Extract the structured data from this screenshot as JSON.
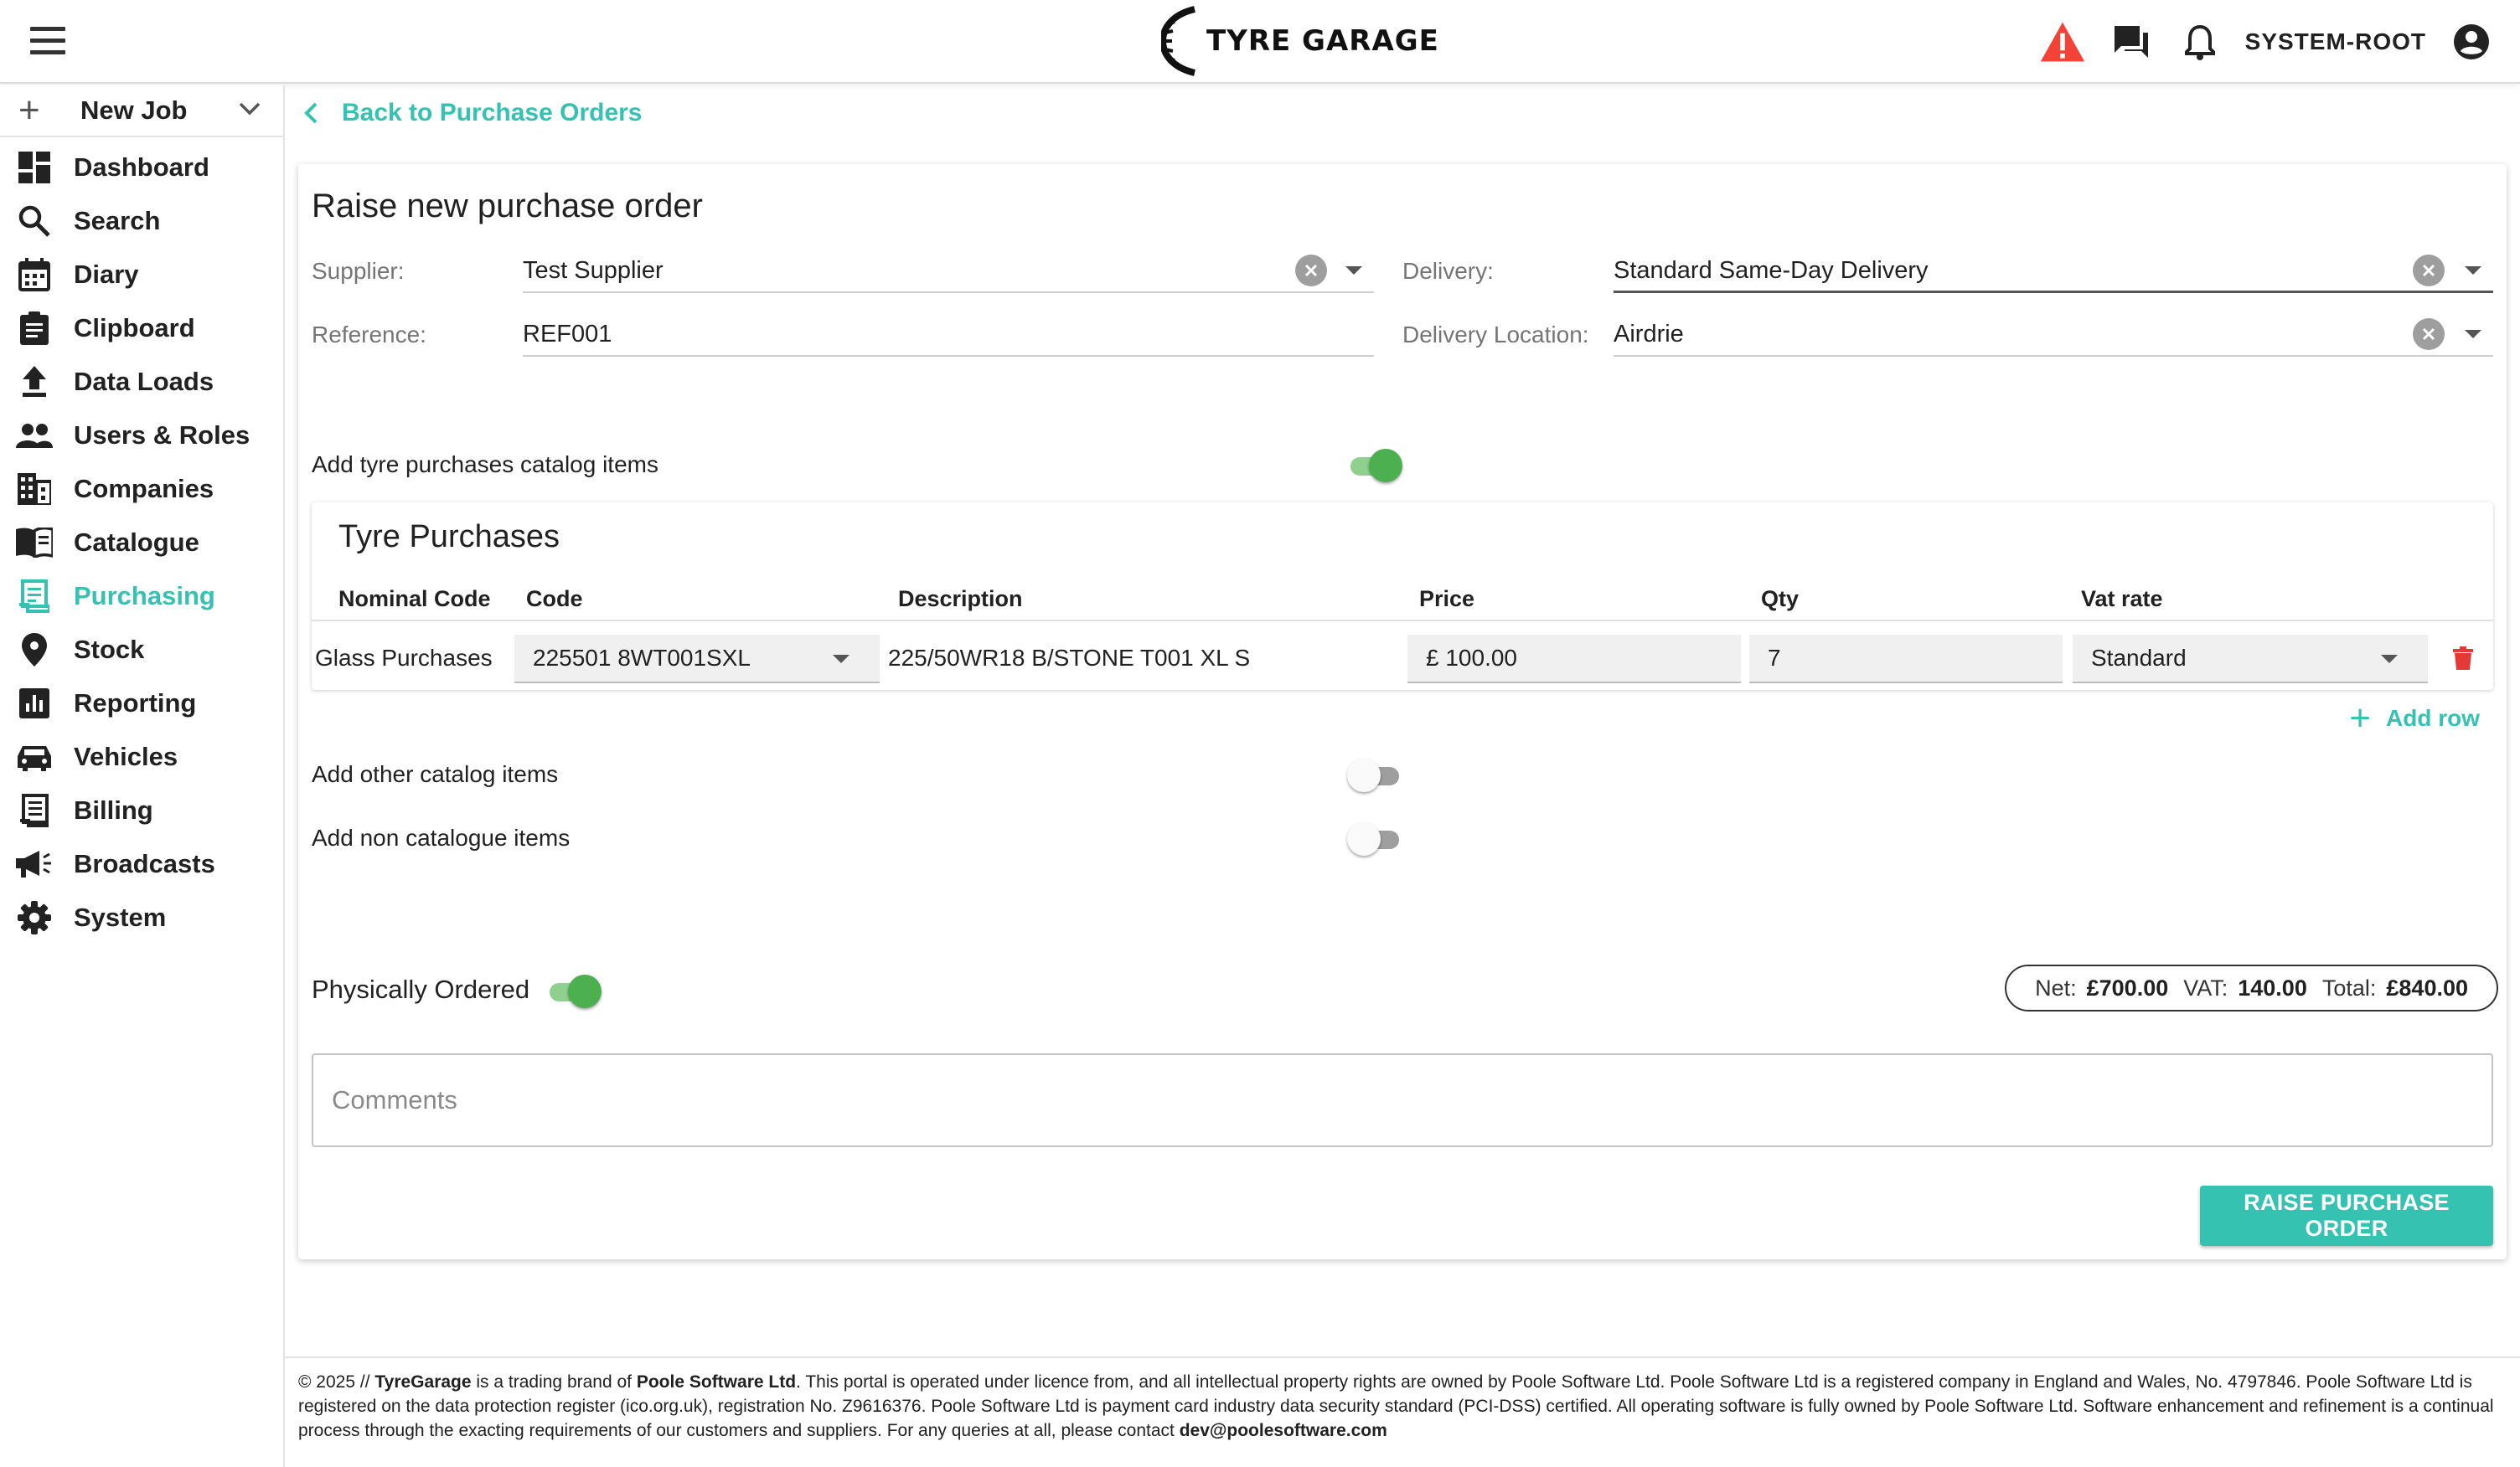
{
  "header": {
    "brand": "TYRE GARAGE",
    "user": "SYSTEM-ROOT",
    "icons": [
      "menu-icon",
      "warning-icon",
      "chat-icon",
      "bell-icon",
      "account-circle-icon"
    ]
  },
  "sidebar": {
    "new_job": "New Job",
    "items": [
      {
        "label": "Dashboard",
        "icon": "dashboard-icon"
      },
      {
        "label": "Search",
        "icon": "search-icon"
      },
      {
        "label": "Diary",
        "icon": "calendar-icon"
      },
      {
        "label": "Clipboard",
        "icon": "clipboard-icon"
      },
      {
        "label": "Data Loads",
        "icon": "upload-icon"
      },
      {
        "label": "Users & Roles",
        "icon": "people-icon"
      },
      {
        "label": "Companies",
        "icon": "building-icon"
      },
      {
        "label": "Catalogue",
        "icon": "book-icon"
      },
      {
        "label": "Purchasing",
        "icon": "receipt-icon"
      },
      {
        "label": "Stock",
        "icon": "location-pin-icon"
      },
      {
        "label": "Reporting",
        "icon": "chart-icon"
      },
      {
        "label": "Vehicles",
        "icon": "car-icon"
      },
      {
        "label": "Billing",
        "icon": "invoice-icon"
      },
      {
        "label": "Broadcasts",
        "icon": "megaphone-icon"
      },
      {
        "label": "System",
        "icon": "gear-icon"
      }
    ],
    "active": "Purchasing"
  },
  "nav": {
    "back": "Back to Purchase Orders"
  },
  "form": {
    "title": "Raise new purchase order",
    "supplier_label": "Supplier:",
    "supplier_value": "Test Supplier",
    "delivery_label": "Delivery:",
    "delivery_value": "Standard Same-Day Delivery",
    "reference_label": "Reference:",
    "reference_value": "REF001",
    "location_label": "Delivery Location:",
    "location_value": "Airdrie"
  },
  "toggles": {
    "tyre": {
      "label": "Add tyre purchases catalog items",
      "on": true
    },
    "other": {
      "label": "Add other catalog items",
      "on": false
    },
    "non": {
      "label": "Add non catalogue items",
      "on": false
    },
    "physical": {
      "label": "Physically Ordered",
      "on": true
    }
  },
  "tyre_table": {
    "title": "Tyre Purchases",
    "headers": [
      "Nominal Code",
      "Code",
      "Description",
      "Price",
      "Qty",
      "Vat rate"
    ],
    "row": {
      "nominal": "Glass Purchases",
      "code": "225501 8WT001SXL",
      "description": "225/50WR18 B/STONE T001 XL S",
      "price": "£ 100.00",
      "qty": "7",
      "vat": "Standard"
    },
    "add_row": "Add row"
  },
  "totals": {
    "net_label": "Net:",
    "net": "£700.00",
    "vat_label": "VAT:",
    "vat": "140.00",
    "total_label": "Total:",
    "total": "£840.00"
  },
  "comments": {
    "placeholder": "Comments"
  },
  "actions": {
    "raise": "RAISE PURCHASE ORDER"
  },
  "footer": {
    "year": "© 2025 // ",
    "brand": "TyreGarage",
    "p1": " is a trading brand of ",
    "company": "Poole Software Ltd",
    "p2": ". This portal is operated under licence from, and all intellectual property rights are owned by Poole Software Ltd. Poole Software Ltd is a registered company in England and Wales, No. 4797846. Poole Software Ltd is registered on the data protection register (ico.org.uk), registration No. Z9616376. Poole Software Ltd is payment card industry data security standard (PCI-DSS) certified. All operating software is fully owned by Poole Software Ltd. Software enhancement and refinement is a continual process through the exacting requirements of our customers and suppliers. For any queries at all, please contact ",
    "email": "dev@poolesoftware.com"
  },
  "colors": {
    "accent": "#36c2b0",
    "toggle_on": "#4caf50",
    "warning": "#f44336",
    "delete": "#e53935"
  }
}
